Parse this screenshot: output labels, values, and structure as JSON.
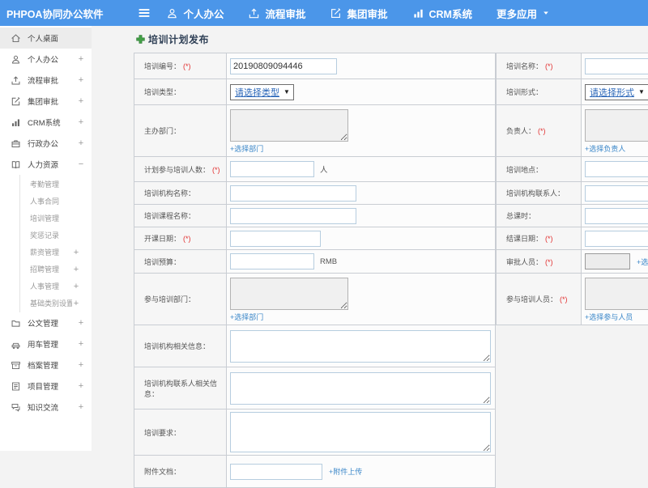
{
  "header": {
    "brand": "PHPOA协同办公软件",
    "nav": [
      {
        "icon": "user-icon",
        "label": "个人办公"
      },
      {
        "icon": "upload-icon",
        "label": "流程审批"
      },
      {
        "icon": "edit-icon",
        "label": "集团审批"
      },
      {
        "icon": "chart-icon",
        "label": "CRM系统"
      },
      {
        "label": "更多应用",
        "caret": "caret-down-icon"
      }
    ]
  },
  "sidebar": {
    "items": [
      {
        "icon": "home-icon",
        "label": "个人桌面",
        "active": true
      },
      {
        "icon": "user-icon",
        "label": "个人办公",
        "expand": "+"
      },
      {
        "icon": "upload-icon",
        "label": "流程审批",
        "expand": "+"
      },
      {
        "icon": "edit-icon",
        "label": "集团审批",
        "expand": "+"
      },
      {
        "icon": "chart-icon",
        "label": "CRM系统",
        "expand": "+"
      },
      {
        "icon": "briefcase-icon",
        "label": "行政办公",
        "expand": "+"
      },
      {
        "icon": "book-icon",
        "label": "人力资源",
        "expand": "−",
        "children": [
          {
            "label": "考勤管理"
          },
          {
            "label": "人事合同"
          },
          {
            "label": "培训管理"
          },
          {
            "label": "奖惩记录"
          },
          {
            "label": "薪资管理",
            "expand": "+"
          },
          {
            "label": "招聘管理",
            "expand": "+"
          },
          {
            "label": "人事管理",
            "expand": "+"
          },
          {
            "label": "基础类别设置",
            "expand": "+"
          }
        ]
      },
      {
        "icon": "folder-icon",
        "label": "公文管理",
        "expand": "+"
      },
      {
        "icon": "car-icon",
        "label": "用车管理",
        "expand": "+"
      },
      {
        "icon": "archive-icon",
        "label": "档案管理",
        "expand": "+"
      },
      {
        "icon": "project-icon",
        "label": "项目管理",
        "expand": "+"
      },
      {
        "icon": "chat-icon",
        "label": "知识交流",
        "expand": "+"
      }
    ]
  },
  "main": {
    "title": "培训计划发布",
    "title_icon": "plus-icon"
  },
  "form": {
    "required_mark": "(*)",
    "left_rows": [
      {
        "label": "培训编号：",
        "required": true,
        "control": {
          "type": "text",
          "value": "20190809094446"
        }
      },
      {
        "label": "培训类型：",
        "control": {
          "type": "select",
          "value": "请选择类型"
        }
      },
      {
        "label": "主办部门：",
        "control": {
          "type": "gray-textarea",
          "link": "+选择部门"
        }
      },
      {
        "label": "计划参与培训人数：",
        "required": true,
        "control": {
          "type": "text",
          "suffix": "人"
        }
      },
      {
        "label": "培训机构名称：",
        "control": {
          "type": "text"
        }
      },
      {
        "label": "培训课程名称：",
        "control": {
          "type": "text"
        }
      },
      {
        "label": "开课日期：",
        "required": true,
        "control": {
          "type": "text"
        }
      },
      {
        "label": "培训预算：",
        "control": {
          "type": "text",
          "suffix": "RMB"
        }
      },
      {
        "label": "参与培训部门：",
        "control": {
          "type": "gray-textarea",
          "link": "+选择部门"
        }
      },
      {
        "label": "培训机构相关信息：",
        "control": {
          "type": "textarea"
        }
      },
      {
        "label": "培训机构联系人相关信息：",
        "control": {
          "type": "textarea"
        }
      },
      {
        "label": "培训要求：",
        "control": {
          "type": "textarea"
        }
      },
      {
        "label": "附件文档：",
        "control": {
          "type": "text",
          "link": "+附件上传"
        }
      }
    ],
    "right_rows": [
      {
        "label": "培训名称：",
        "required": true,
        "control": {
          "type": "text"
        }
      },
      {
        "label": "培训形式：",
        "control": {
          "type": "select",
          "value": "请选择形式"
        }
      },
      {
        "label": "负责人：",
        "required": true,
        "control": {
          "type": "gray-textarea",
          "link": "+选择负责人"
        }
      },
      {
        "label": "培训地点：",
        "control": {
          "type": "text"
        }
      },
      {
        "label": "培训机构联系人：",
        "control": {
          "type": "text"
        }
      },
      {
        "label": "总课时：",
        "control": {
          "type": "text"
        }
      },
      {
        "label": "结课日期：",
        "required": true,
        "control": {
          "type": "text"
        }
      },
      {
        "label": "审批人员：",
        "required": true,
        "control": {
          "type": "graybox",
          "link": "+选择审批人员"
        }
      },
      {
        "label": "参与培训人员：",
        "required": true,
        "control": {
          "type": "gray-textarea",
          "link": "+选择参与人员"
        }
      }
    ]
  }
}
